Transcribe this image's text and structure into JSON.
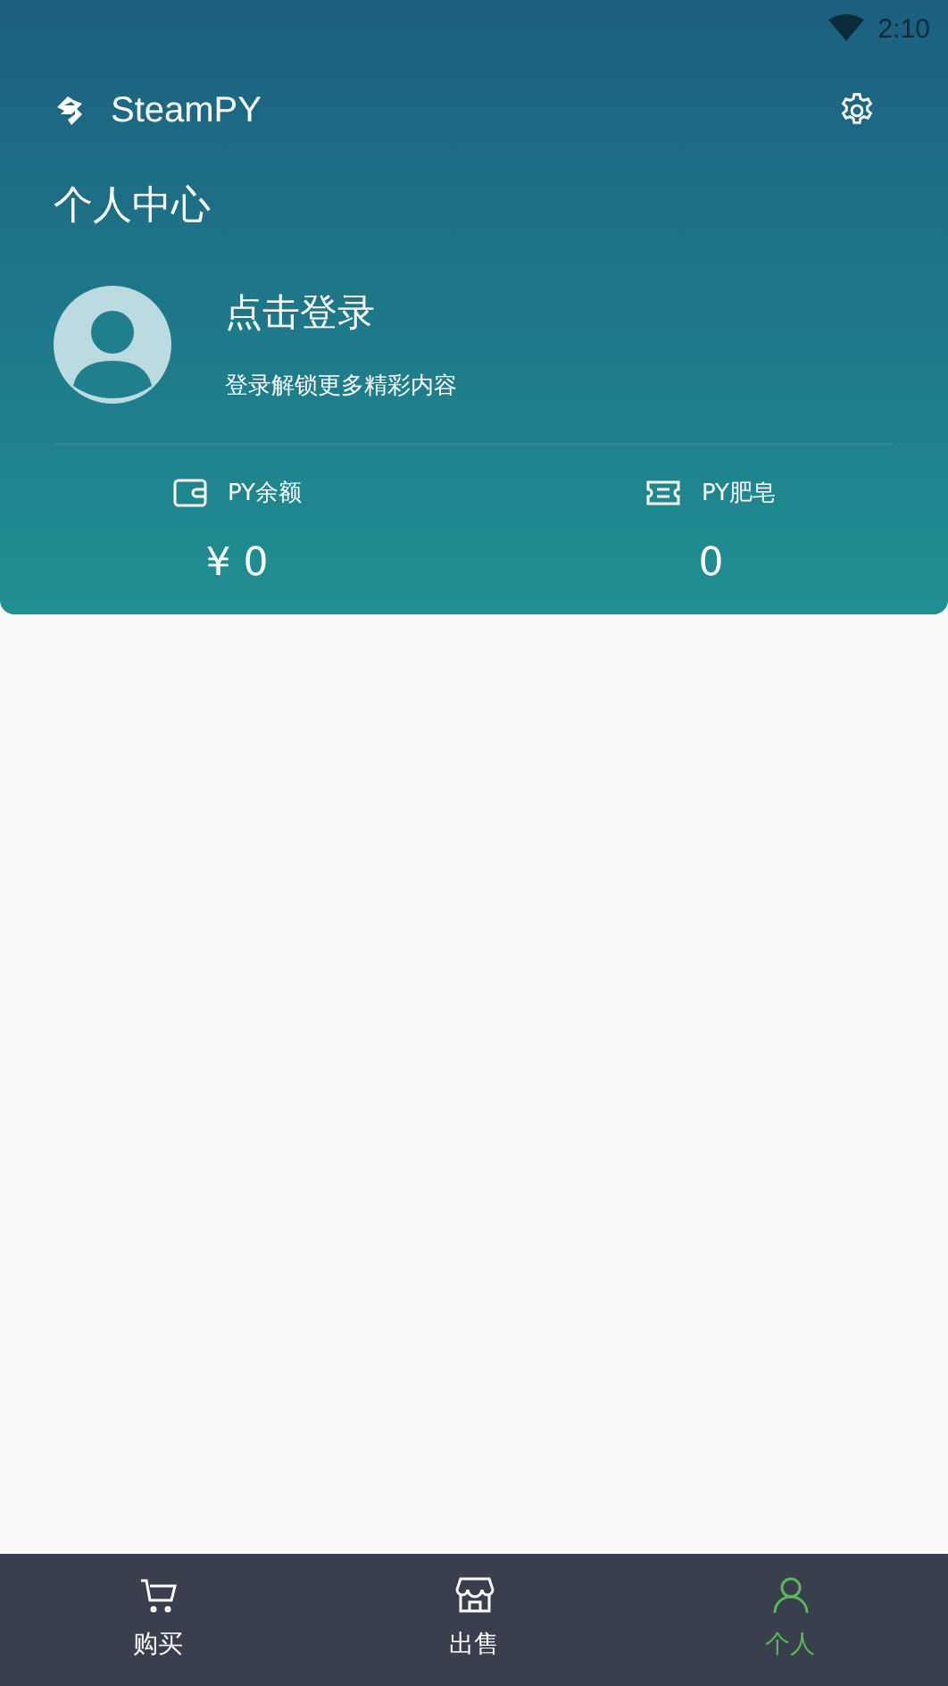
{
  "status_bar": {
    "time": "2:10"
  },
  "header": {
    "app_name": "SteamPY",
    "page_title": "个人中心"
  },
  "profile": {
    "title": "点击登录",
    "subtitle": "登录解锁更多精彩内容"
  },
  "stats": [
    {
      "kind": "wallet",
      "label": "PY余额",
      "value": "¥ 0"
    },
    {
      "kind": "ticket",
      "label": "PY肥皂",
      "value": "0"
    }
  ],
  "tabs": [
    {
      "kind": "cart",
      "label": "购买",
      "selected": false
    },
    {
      "kind": "store",
      "label": "出售",
      "selected": false
    },
    {
      "kind": "person",
      "label": "个人",
      "selected": true
    }
  ]
}
